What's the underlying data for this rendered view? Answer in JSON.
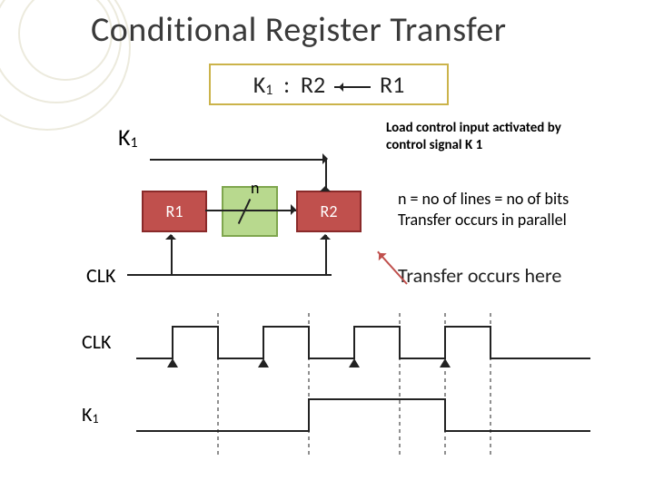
{
  "title": "Conditional Register Transfer",
  "notation": {
    "k": "K",
    "ksub": "1",
    "colon": ":",
    "dst": "R2",
    "src": "R1"
  },
  "k1_label": {
    "letter": "K",
    "sub": "1"
  },
  "load_caption_l1": "Load control input activated by",
  "load_caption_l2": "control signal K 1",
  "reg1": "R1",
  "reg2": "R2",
  "bus_letter": "n",
  "bus_caption_l1": "n = no of lines = no of bits",
  "bus_caption_l2": "Transfer occurs in parallel",
  "clk_label": "CLK",
  "transfer_text": "Transfer occurs here",
  "timing": {
    "clk_label": "CLK",
    "k1_label_letter": "K",
    "k1_label_sub": "1"
  },
  "colors": {
    "register_fill": "#c0504d",
    "register_border": "#8a2a2a",
    "bus_box_fill": "#b8d98e",
    "bus_box_border": "#7fa64e",
    "notation_border": "#cbb34a",
    "red_arrow": "#c0504d"
  }
}
